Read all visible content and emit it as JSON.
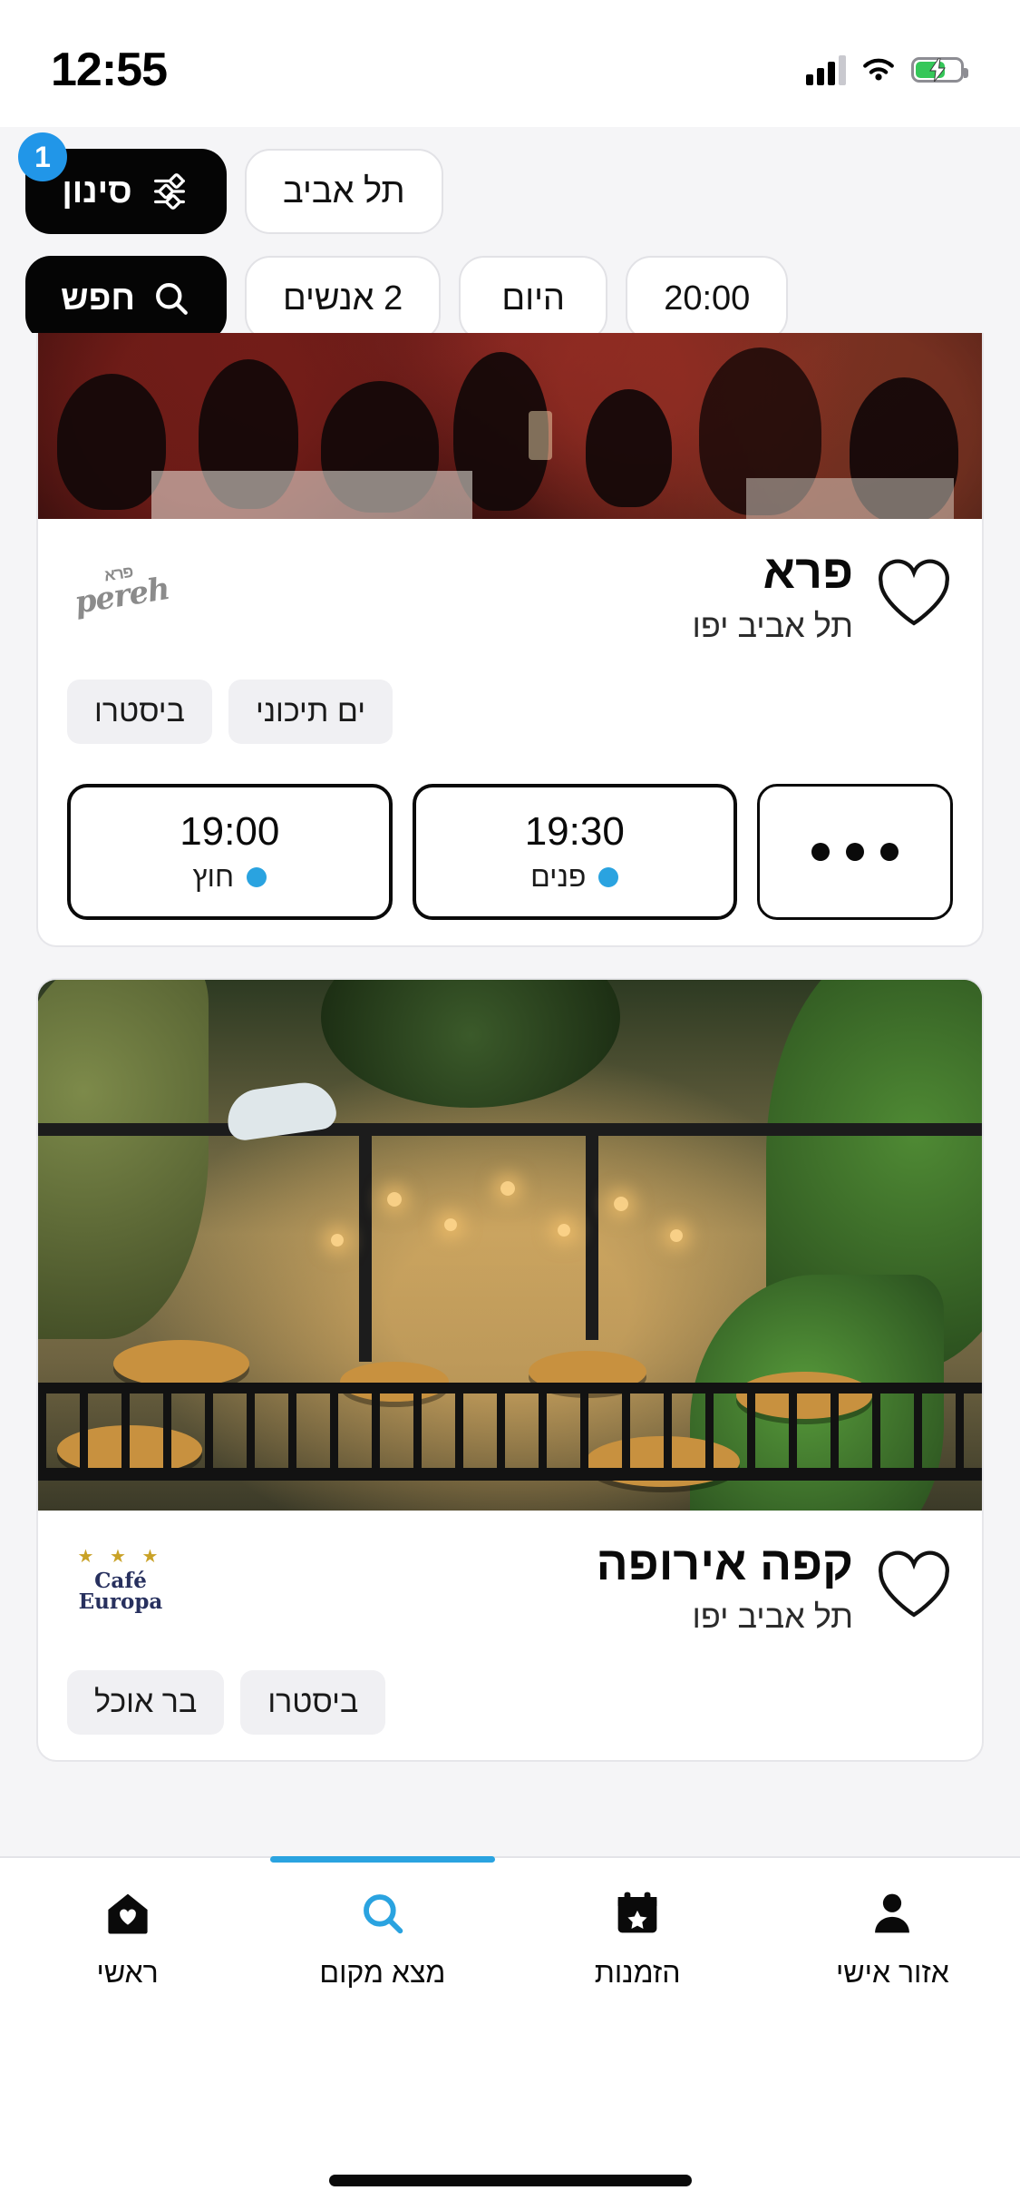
{
  "status_bar": {
    "time": "12:55",
    "cellular_icon": "cellular-bars-icon",
    "wifi_icon": "wifi-icon",
    "battery_icon": "battery-charging-icon"
  },
  "filter_bar": {
    "filter_button": {
      "label": "סינון",
      "icon": "sliders-icon",
      "badge": "1"
    },
    "city_chip": {
      "label": "תל אביב"
    },
    "search_button": {
      "label": "חפש",
      "icon": "search-icon"
    },
    "party_chip": {
      "label": "2 אנשים"
    },
    "date_chip": {
      "label": "היום"
    },
    "time_chip": {
      "label": "20:00"
    },
    "accent_color": "#2196e8",
    "dark_color": "#050505"
  },
  "results": [
    {
      "name": "פרא",
      "location": "תל אביב יפו",
      "logo_text": "pereh",
      "logo_sub": "פרא",
      "favorite_icon": "heart-outline-icon",
      "tags": [
        "ביסטרו",
        "ים תיכוני"
      ],
      "slots": [
        {
          "time": "19:00",
          "area": "חוץ",
          "dot_color": "#2aa3e0"
        },
        {
          "time": "19:30",
          "area": "פנים",
          "dot_color": "#2aa3e0"
        }
      ],
      "more_label": "•••"
    },
    {
      "name": "קפה אירופה",
      "location": "תל אביב יפו",
      "logo_text": "Café Europa",
      "logo_stars": "★ ★ ★",
      "favorite_icon": "heart-outline-icon",
      "tags": [
        "בר אוכל",
        "ביסטרו"
      ],
      "slots": [],
      "more_label": ""
    }
  ],
  "tab_bar": {
    "active_color": "#2aa3e0",
    "items": [
      {
        "label": "ראשי",
        "icon": "home-heart-icon",
        "active": false
      },
      {
        "label": "מצא מקום",
        "icon": "search-icon",
        "active": true
      },
      {
        "label": "הזמנות",
        "icon": "calendar-star-icon",
        "active": false
      },
      {
        "label": "אזור אישי",
        "icon": "person-icon",
        "active": false
      }
    ]
  }
}
